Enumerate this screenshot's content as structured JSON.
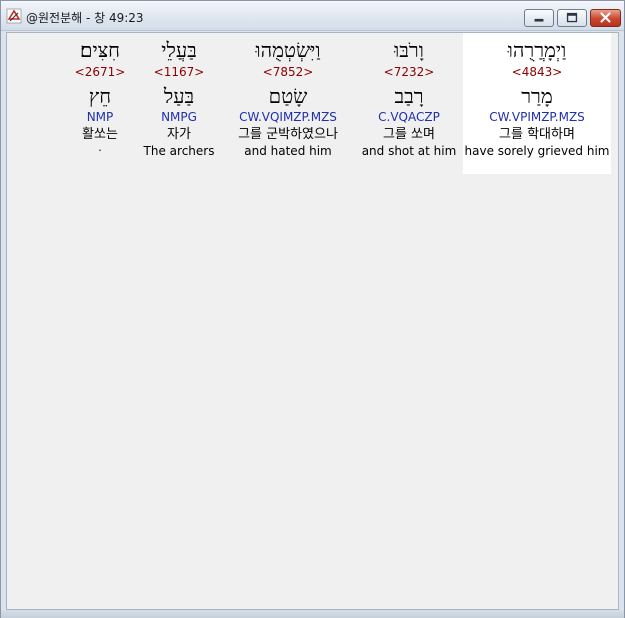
{
  "window": {
    "title": "@원전분해 - 창 49:23"
  },
  "words": [
    {
      "hebrew": "חִצִּים׃",
      "strong": "<2671>",
      "lemma": "חֵץ",
      "morph": "NMP",
      "korean": "활쏘는",
      "english": ".",
      "selected": false
    },
    {
      "hebrew": "בַּעֲלֵי",
      "strong": "<1167>",
      "lemma": "בַּעַל",
      "morph": "NMPG",
      "korean": "자가",
      "english": "The archers",
      "selected": false
    },
    {
      "hebrew": "וַיִּשְׂטְמֻהוּ",
      "strong": "<7852>",
      "lemma": "שָׂטַם",
      "morph": "CW.VQIMZP.MZS",
      "korean": "그를 군박하였으나",
      "english": "and hated him",
      "selected": false
    },
    {
      "hebrew": "וָרֹבּוּ",
      "strong": "<7232>",
      "lemma": "רָבַב",
      "morph": "C.VQACZP",
      "korean": "그를 쏘며",
      "english": "and shot at him",
      "selected": false
    },
    {
      "hebrew": "וַיְמָרֲרֻהוּ",
      "strong": "<4843>",
      "lemma": "מָרַר",
      "morph": "CW.VPIMZP.MZS",
      "korean": "그를 학대하며",
      "english": "have sorely grieved him",
      "selected": true
    }
  ]
}
